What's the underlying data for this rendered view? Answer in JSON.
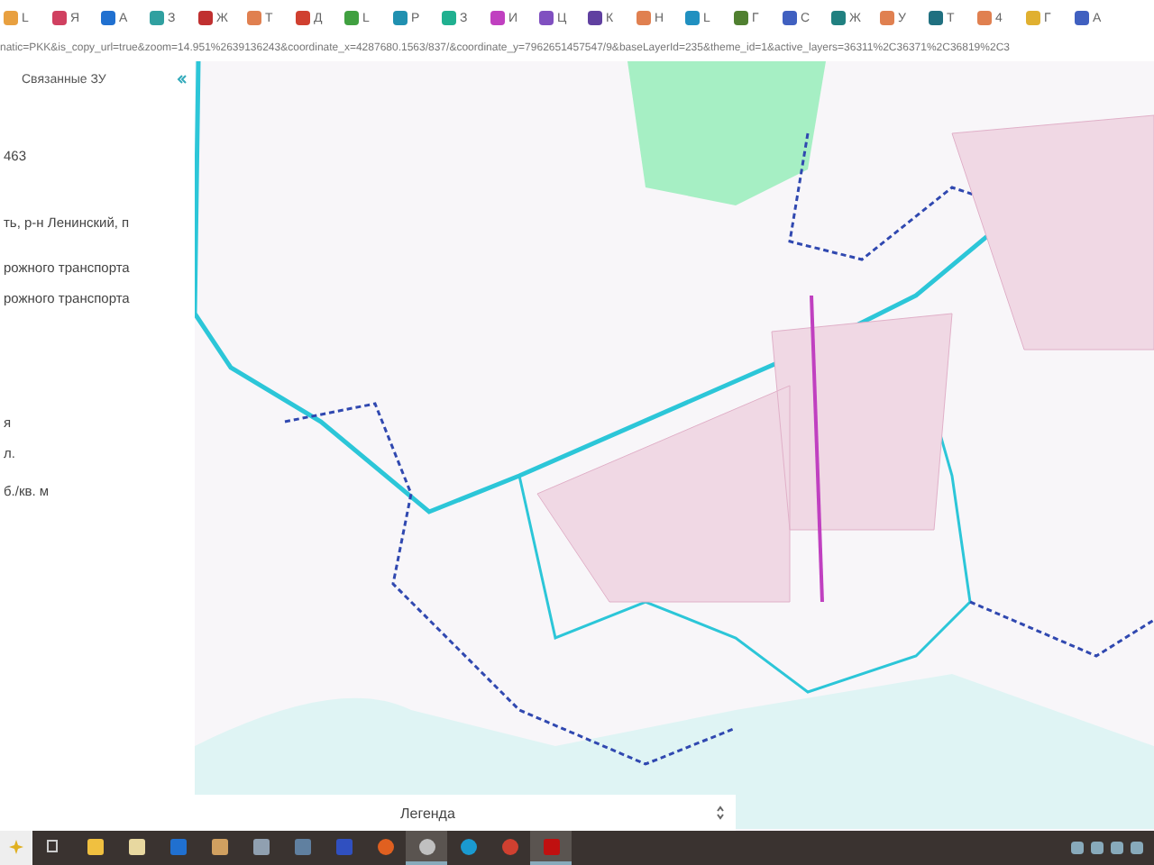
{
  "bookmarks": [
    {
      "label": "L",
      "color": "#e8a040"
    },
    {
      "label": "Я",
      "color": "#d04060"
    },
    {
      "label": "A",
      "color": "#2070d0"
    },
    {
      "label": "З",
      "color": "#30a0a0"
    },
    {
      "label": "Ж",
      "color": "#c03030"
    },
    {
      "label": "Т",
      "color": "#e08050"
    },
    {
      "label": "Д",
      "color": "#d04030"
    },
    {
      "label": "L",
      "color": "#40a040"
    },
    {
      "label": "P",
      "color": "#2090b0"
    },
    {
      "label": "З",
      "color": "#20b090"
    },
    {
      "label": "И",
      "color": "#c040c0"
    },
    {
      "label": "Ц",
      "color": "#8050c0"
    },
    {
      "label": "К",
      "color": "#6040a0"
    },
    {
      "label": "Н",
      "color": "#e08050"
    },
    {
      "label": "L",
      "color": "#2090c0"
    },
    {
      "label": "Г",
      "color": "#508030"
    },
    {
      "label": "С",
      "color": "#4060c0"
    },
    {
      "label": "Ж",
      "color": "#208080"
    },
    {
      "label": "У",
      "color": "#e08050"
    },
    {
      "label": "Т",
      "color": "#207080"
    },
    {
      "label": "4",
      "color": "#e08050"
    },
    {
      "label": "Г",
      "color": "#e0b030"
    },
    {
      "label": "A",
      "color": "#4060c0"
    }
  ],
  "url": "natic=PKK&is_copy_url=true&zoom=14.951%2639136243&coordinate_x=4287680.1563/837/&coordinate_y=7962651457547/9&baseLayerId=235&theme_id=1&active_layers=36311%2C36371%2C36819%2C3",
  "panel": {
    "tab": "Связанные ЗУ",
    "lines": [
      "463",
      "ть, р-н Ленинский, п",
      "рожного транспорта",
      "рожного транспорта",
      "я",
      "л.",
      "б./кв. м"
    ]
  },
  "legend": {
    "title": "Легенда"
  },
  "taskbar": {
    "apps": [
      {
        "kind": "explorer",
        "active": false
      },
      {
        "kind": "calendar",
        "active": false
      },
      {
        "kind": "mail",
        "active": false
      },
      {
        "kind": "video",
        "active": false
      },
      {
        "kind": "paint",
        "active": false
      },
      {
        "kind": "calc",
        "active": false
      },
      {
        "kind": "save",
        "active": false
      },
      {
        "kind": "firefox",
        "active": false
      },
      {
        "kind": "at",
        "active": true
      },
      {
        "kind": "edge",
        "active": false
      },
      {
        "kind": "chrome",
        "active": false
      },
      {
        "kind": "pdf",
        "active": true
      }
    ]
  }
}
